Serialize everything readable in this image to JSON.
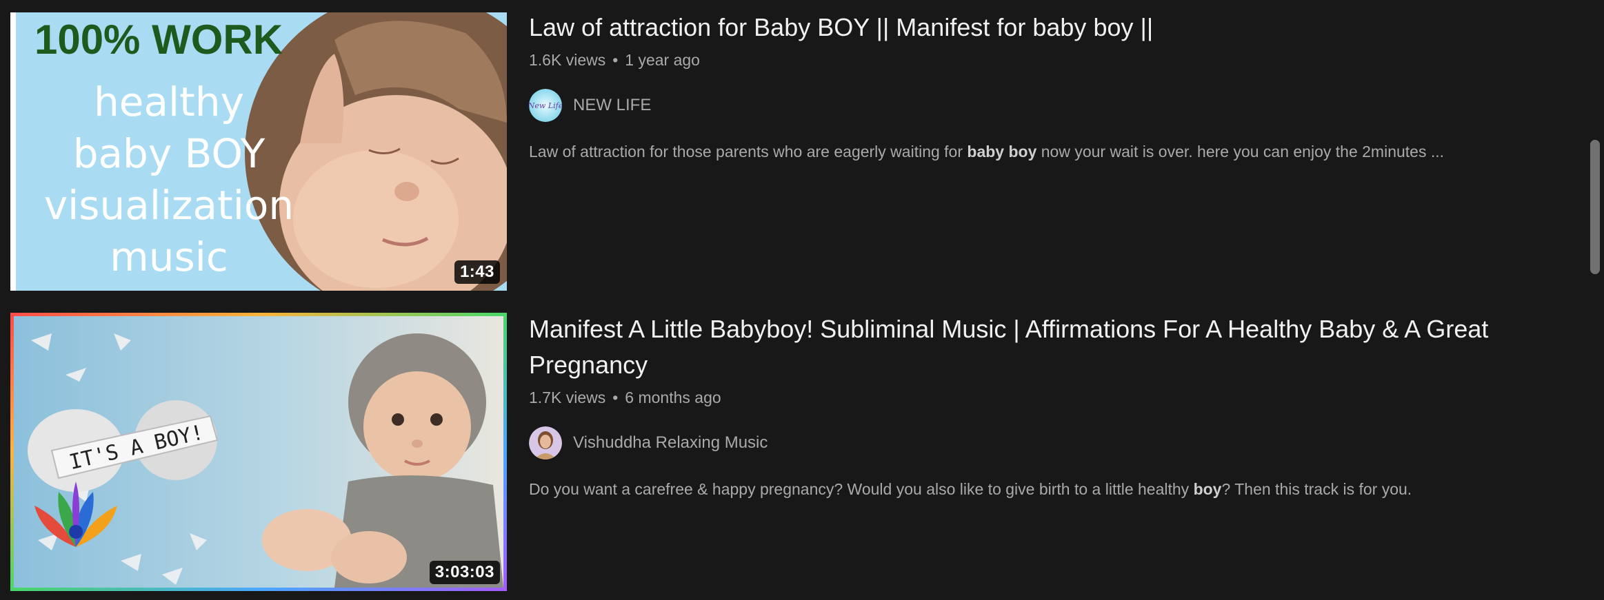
{
  "results": [
    {
      "thumbnail": {
        "headline": "100% WORK",
        "lines": [
          "healthy",
          "baby BOY",
          "visualization",
          "music"
        ],
        "duration": "1:43"
      },
      "title": "Law of attraction for Baby BOY || Manifest for baby boy ||",
      "views": "1.6K views",
      "age": "1 year ago",
      "channel": {
        "name": "NEW LIFE",
        "avatar_text": "New Life"
      },
      "description": {
        "before": "Law of attraction for those parents who are eagerly waiting for ",
        "bold": "baby boy",
        "after": " now your wait is over. here you can enjoy the 2minutes ..."
      }
    },
    {
      "thumbnail": {
        "banner_text": "IT'S A BOY!",
        "duration": "3:03:03"
      },
      "title": "Manifest A Little Babyboy! Subliminal Music | Affirmations For A Healthy Baby & A Great Pregnancy",
      "views": "1.7K views",
      "age": "6 months ago",
      "channel": {
        "name": "Vishuddha Relaxing Music"
      },
      "description": {
        "before": "Do you want a carefree & happy pregnancy? Would you also like to give birth to a little healthy ",
        "bold": "boy",
        "after": "? Then this track is for you."
      }
    }
  ],
  "colors": {
    "background": "#181818",
    "title": "#f1f1f1",
    "secondary_text": "#aaaaaa",
    "thumb1_sky": "#a9dcf2",
    "thumb1_headline": "#1d5a1d",
    "thumb2_sky": "#9fc9e0"
  }
}
